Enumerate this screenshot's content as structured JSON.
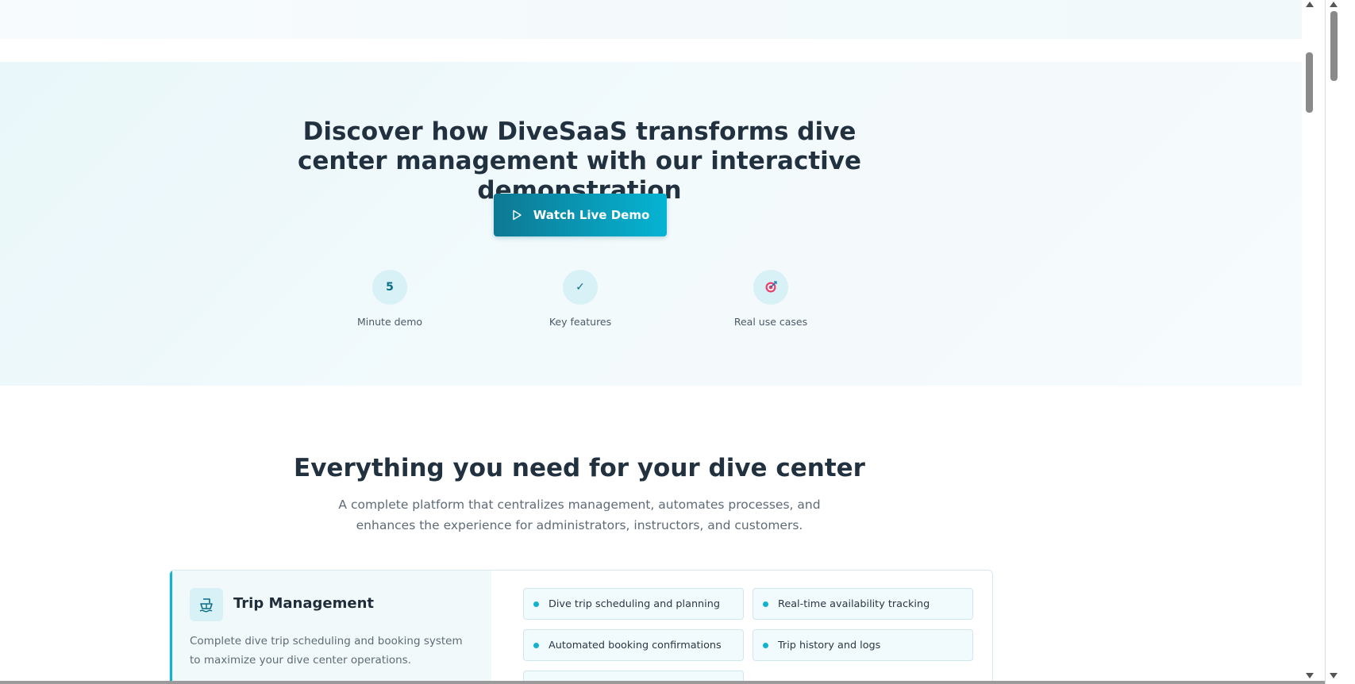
{
  "hero": {
    "title": "Discover how DiveSaaS transforms dive center management with our interactive demonstration",
    "cta_label": "Watch Live Demo",
    "stats": [
      {
        "icon": "5",
        "label": "Minute demo"
      },
      {
        "icon": "✓",
        "label": "Key features"
      },
      {
        "icon": "target-icon",
        "label": "Real use cases"
      }
    ]
  },
  "features": {
    "title": "Everything you need for your dive center",
    "subtitle": "A complete platform that centralizes management, automates processes, and enhances the experience for administrators, instructors, and customers.",
    "cards": [
      {
        "icon": "boat-icon",
        "name": "Trip Management",
        "description": "Complete dive trip scheduling and booking system to maximize your dive center operations.",
        "items": [
          "Dive trip scheduling and planning",
          "Real-time availability tracking",
          "Automated booking confirmations",
          "Trip history and logs"
        ]
      }
    ]
  },
  "colors": {
    "accent": "#13b3cf",
    "button_start": "#0e7893",
    "button_end": "#05b4d3",
    "heading": "#22313f"
  }
}
